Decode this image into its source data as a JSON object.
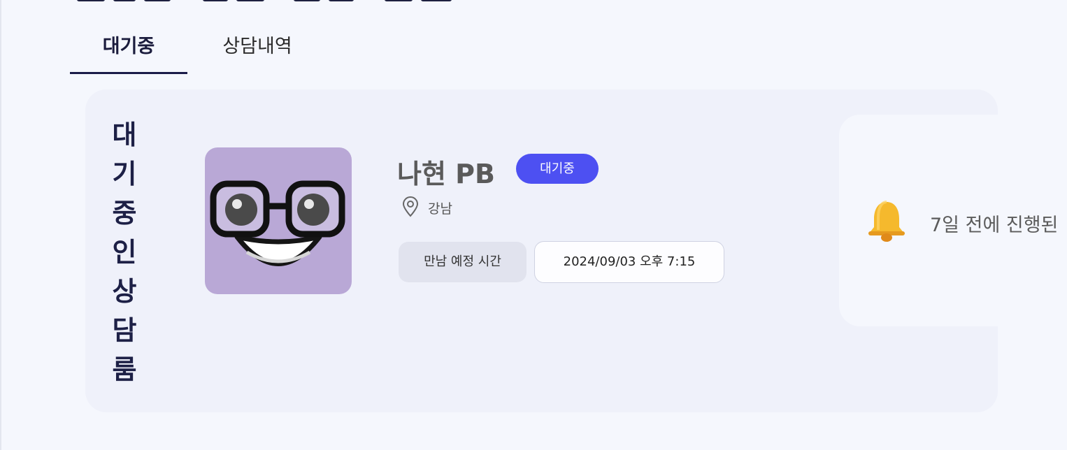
{
  "tabs": [
    {
      "label": "대기중",
      "active": true
    },
    {
      "label": "상담내역",
      "active": false
    }
  ],
  "room": {
    "title": "대기중인상담룸",
    "pb_name": "나현 PB",
    "status_badge": "대기중",
    "location": "강남",
    "location_icon": "map-pin-icon",
    "meeting_label": "만남 예정 시간",
    "meeting_time": "2024/09/03 오후 7:15",
    "avatar_icon": "nerd-face-avatar"
  },
  "notice": {
    "icon": "bell-icon",
    "text": "7일 전에 진행된"
  },
  "colors": {
    "accent": "#4d50f2",
    "tab_underline": "#1b1c4a",
    "avatar_bg": "#b9a8d6",
    "page_bg": "#f5f7fd",
    "card_bg": "#eff1fa"
  }
}
